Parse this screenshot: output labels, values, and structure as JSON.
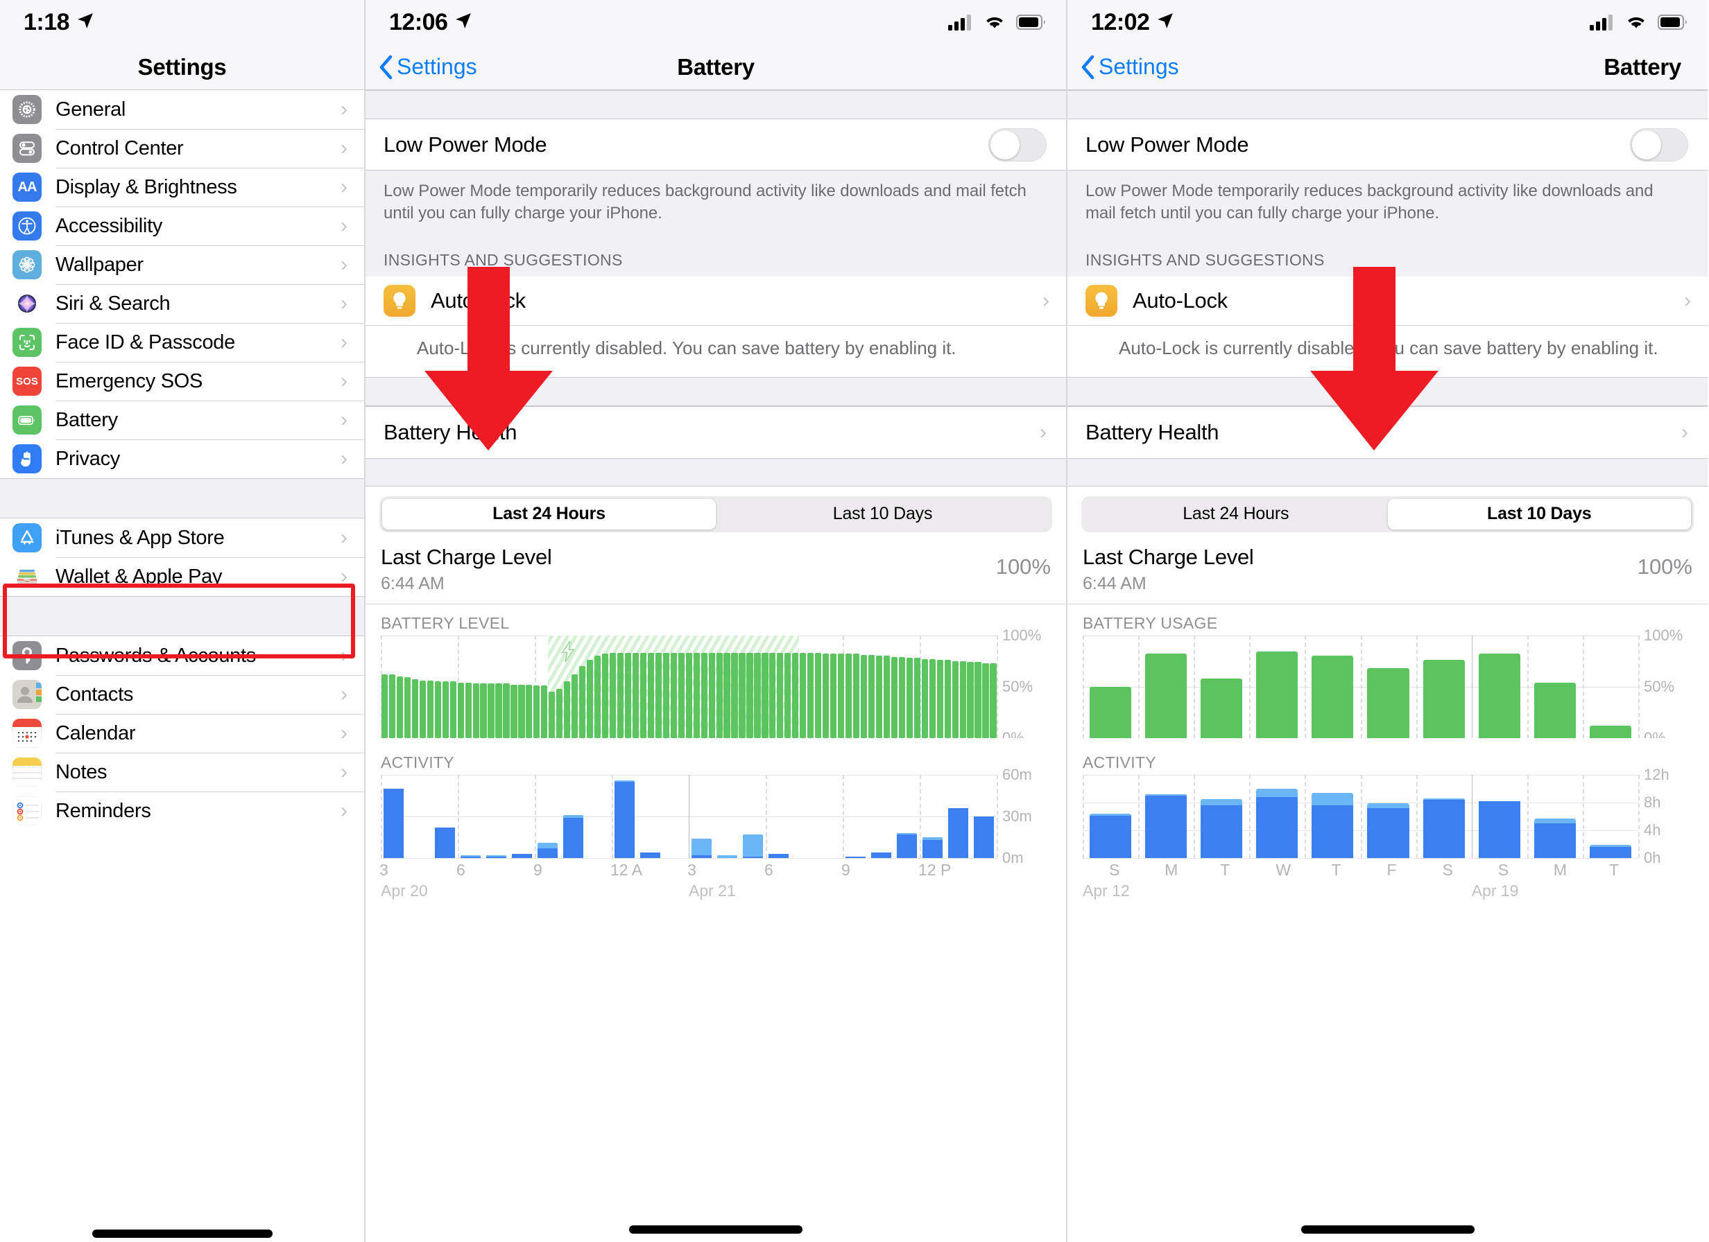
{
  "panels": {
    "left": {
      "status": {
        "time": "1:18",
        "location_icon": "location-arrow-icon"
      },
      "nav": {
        "title": "Settings"
      },
      "groups": [
        {
          "items": [
            {
              "label": "General",
              "icon": "gear-icon",
              "color": "#8e8e93"
            },
            {
              "label": "Control Center",
              "icon": "toggles-icon",
              "color": "#8e8e93"
            },
            {
              "label": "Display & Brightness",
              "icon": "aa-text-icon",
              "color": "#357aec"
            },
            {
              "label": "Accessibility",
              "icon": "accessibility-icon",
              "color": "#357aec"
            },
            {
              "label": "Wallpaper",
              "icon": "flower-icon",
              "color": "#5eaede"
            },
            {
              "label": "Siri & Search",
              "icon": "siri-icon",
              "color": "#1c1c2e"
            },
            {
              "label": "Face ID & Passcode",
              "icon": "face-id-icon",
              "color": "#5dc466"
            },
            {
              "label": "Emergency SOS",
              "icon": "sos-icon",
              "color": "#f04438"
            },
            {
              "label": "Battery",
              "icon": "battery-icon",
              "color": "#5dc466"
            },
            {
              "label": "Privacy",
              "icon": "hand-icon",
              "color": "#2f7cf6"
            }
          ]
        },
        {
          "items": [
            {
              "label": "iTunes & App Store",
              "icon": "app-store-icon",
              "color": "#3fa0f5"
            },
            {
              "label": "Wallet & Apple Pay",
              "icon": "wallet-icon",
              "color": "#1c1c1e"
            }
          ]
        },
        {
          "items": [
            {
              "label": "Passwords & Accounts",
              "icon": "key-icon",
              "color": "#8e8e93"
            },
            {
              "label": "Contacts",
              "icon": "contacts-icon",
              "color": "#d7d4cd"
            },
            {
              "label": "Calendar",
              "icon": "calendar-icon",
              "color": "#ffffff"
            },
            {
              "label": "Notes",
              "icon": "notes-icon",
              "color": "#ffffff"
            },
            {
              "label": "Reminders",
              "icon": "reminders-icon",
              "color": "#ffffff"
            }
          ]
        }
      ],
      "highlight_color": "#ed1c24",
      "highlighted_item": "Battery"
    },
    "middle": {
      "status": {
        "time": "12:06",
        "location_icon": "location-arrow-icon"
      },
      "nav": {
        "back_label": "Settings",
        "title": "Battery"
      },
      "low_power": {
        "label": "Low Power Mode",
        "enabled": false,
        "footnote": "Low Power Mode temporarily reduces background activity like downloads and mail fetch until you can fully charge your iPhone."
      },
      "insights": {
        "header": "INSIGHTS AND SUGGESTIONS",
        "item_label": "Auto-Lock",
        "body": "Auto-Lock is currently disabled. You can save battery by enabling it."
      },
      "battery_health": {
        "label": "Battery Health"
      },
      "segmented": {
        "options": [
          "Last 24 Hours",
          "Last 10 Days"
        ],
        "selected_index": 0
      },
      "last_charge": {
        "title": "Last Charge Level",
        "time": "6:44 AM",
        "percent": "100%"
      },
      "arrow_overlay": {
        "color": "#ed1c24",
        "direction": "down"
      }
    },
    "right": {
      "status": {
        "time": "12:02",
        "location_icon": "location-arrow-icon"
      },
      "nav": {
        "back_label": "Settings",
        "title": "Battery"
      },
      "low_power": {
        "label": "Low Power Mode",
        "enabled": false,
        "footnote": "Low Power Mode temporarily reduces background activity like downloads and mail fetch until you can fully charge your iPhone."
      },
      "insights": {
        "header": "INSIGHTS AND SUGGESTIONS",
        "item_label": "Auto-Lock",
        "body": "Auto-Lock is currently disabled. You can save battery by enabling it."
      },
      "battery_health": {
        "label": "Battery Health"
      },
      "segmented": {
        "options": [
          "Last 24 Hours",
          "Last 10 Days"
        ],
        "selected_index": 1
      },
      "last_charge": {
        "title": "Last Charge Level",
        "time": "6:44 AM",
        "percent": "100%"
      },
      "arrow_overlay": {
        "color": "#ed1c24",
        "direction": "down"
      }
    }
  },
  "chart_data": [
    {
      "id": "mid_battery_level",
      "type": "bar",
      "title": "BATTERY LEVEL",
      "ylabel": "",
      "ylim": [
        0,
        100
      ],
      "yticks": [
        0,
        50,
        100
      ],
      "ytick_labels": [
        "0%",
        "50%",
        "100%"
      ],
      "xticks": [
        "3",
        "6",
        "9",
        "12 A",
        "3",
        "6",
        "9",
        "12 P"
      ],
      "date_labels": [
        "Apr 20",
        "Apr 21"
      ],
      "color": "#5bc45f",
      "charging_region": {
        "start_index": 22,
        "end_index": 55,
        "hatched": true,
        "icon": "lightning-bolt-icon"
      },
      "values": [
        62,
        62,
        60,
        59,
        57,
        56,
        56,
        55,
        55,
        55,
        54,
        54,
        53,
        53,
        53,
        53,
        53,
        52,
        52,
        52,
        51,
        51,
        45,
        48,
        55,
        62,
        70,
        76,
        80,
        82,
        83,
        83,
        83,
        83,
        83,
        83,
        83,
        83,
        83,
        83,
        83,
        83,
        83,
        83,
        83,
        83,
        83,
        83,
        83,
        83,
        83,
        83,
        83,
        83,
        83,
        83,
        83,
        83,
        82,
        82,
        82,
        82,
        82,
        81,
        81,
        80,
        80,
        79,
        79,
        78,
        78,
        77,
        77,
        76,
        76,
        75,
        75,
        74,
        74,
        73,
        73
      ]
    },
    {
      "id": "mid_activity",
      "type": "bar",
      "title": "ACTIVITY",
      "ylim": [
        0,
        60
      ],
      "yticks": [
        0,
        30,
        60
      ],
      "ytick_labels": [
        "0m",
        "30m",
        "60m"
      ],
      "xticks": [
        "3",
        "6",
        "9",
        "12 A",
        "3",
        "6",
        "9",
        "12 P"
      ],
      "date_labels": [
        "Apr 20",
        "Apr 21"
      ],
      "series": [
        {
          "name": "screen-on",
          "color": "#3b7ff0",
          "values": [
            50,
            0,
            22,
            1,
            1,
            3,
            7,
            29,
            0,
            55,
            4,
            0,
            2,
            0,
            1,
            3,
            0,
            0,
            1,
            4,
            17,
            13,
            36,
            30
          ]
        },
        {
          "name": "screen-off",
          "color": "#6bb6f7",
          "values": [
            0,
            0,
            0,
            1,
            1,
            0,
            4,
            2,
            0,
            1,
            0,
            0,
            12,
            2,
            16,
            0,
            0,
            0,
            0,
            0,
            1,
            2,
            0,
            0
          ]
        }
      ]
    },
    {
      "id": "right_battery_usage",
      "type": "bar",
      "title": "BATTERY USAGE",
      "ylim": [
        0,
        100
      ],
      "yticks": [
        0,
        50,
        100
      ],
      "ytick_labels": [
        "0%",
        "50%",
        "100%"
      ],
      "categories": [
        "S",
        "M",
        "T",
        "W",
        "T",
        "F",
        "S",
        "S",
        "M",
        "T"
      ],
      "date_labels": [
        "Apr 12",
        "Apr 19"
      ],
      "color": "#5bc45f",
      "values": [
        50,
        82,
        58,
        84,
        80,
        68,
        76,
        82,
        54,
        12
      ]
    },
    {
      "id": "right_activity",
      "type": "bar",
      "title": "ACTIVITY",
      "ylim": [
        0,
        12
      ],
      "yticks": [
        0,
        4,
        8,
        12
      ],
      "ytick_labels": [
        "0h",
        "4h",
        "8h",
        "12h"
      ],
      "categories": [
        "S",
        "M",
        "T",
        "W",
        "T",
        "F",
        "S",
        "S",
        "M",
        "T"
      ],
      "date_labels": [
        "Apr 12",
        "Apr 19"
      ],
      "series": [
        {
          "name": "screen-on",
          "color": "#3b7ff0",
          "values": [
            6.1,
            9.0,
            7.6,
            8.8,
            7.6,
            7.2,
            8.4,
            8.2,
            5.0,
            1.6
          ]
        },
        {
          "name": "screen-off",
          "color": "#6bb6f7",
          "values": [
            0.25,
            0.2,
            0.9,
            1.2,
            1.8,
            0.7,
            0.2,
            0.0,
            0.7,
            0.3
          ]
        }
      ]
    }
  ]
}
